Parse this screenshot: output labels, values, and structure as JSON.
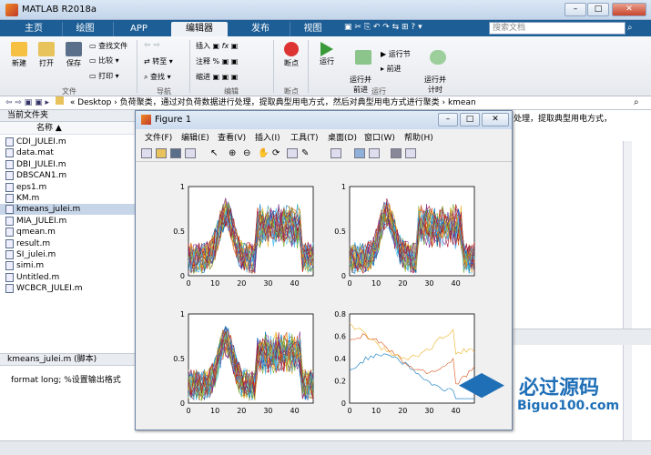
{
  "app": {
    "title": "MATLAB R2018a"
  },
  "tabs": [
    "主页",
    "绘图",
    "APP",
    "编辑器",
    "发布",
    "视图"
  ],
  "active_tab": 3,
  "search": {
    "placeholder": "搜索文档"
  },
  "ribbon": {
    "file_group": {
      "label": "文件",
      "new": "新建",
      "open": "打开",
      "save": "保存",
      "find_files": "查找文件",
      "compare": "比较",
      "print": "打印"
    },
    "nav_group": {
      "label": "导航",
      "goto": "转至",
      "find": "查找"
    },
    "edit_group": {
      "label": "编辑",
      "insert": "插入",
      "comment": "注释",
      "indent": "缩进"
    },
    "breakpoint_group": {
      "label": "断点",
      "breakpoint": "断点"
    },
    "run_group": {
      "label": "运行",
      "run": "运行",
      "run_advance": "运行并\n前进",
      "run_section": "运行节",
      "advance": "前进",
      "run_time": "运行并\n计时"
    }
  },
  "address": {
    "path": "« Desktop › 负荷聚类，通过对负荷数据进行处理，提取典型用电方式，然后对典型用电方式进行聚类 › kmean"
  },
  "current_folder": {
    "title": "当前文件夹",
    "col_name": "名称",
    "files": [
      "CDI_JULEI.m",
      "data.mat",
      "DBI_JULEI.m",
      "DBSCAN1.m",
      "eps1.m",
      "KM.m",
      "kmeans_julei.m",
      "MIA_JULEI.m",
      "qmean.m",
      "result.m",
      "SI_julei.m",
      "simi.m",
      "Untitled.m",
      "WCBCR_JULEI.m"
    ],
    "selected_index": 6
  },
  "details": {
    "header": "kmeans_julei.m (脚本)",
    "content": "format long; %设置输出格式"
  },
  "right_text": "处理，提取典型用电方式，",
  "figure": {
    "title": "Figure 1",
    "menu": [
      "文件(F)",
      "编辑(E)",
      "查看(V)",
      "插入(I)",
      "工具(T)",
      "桌面(D)",
      "窗口(W)",
      "帮助(H)"
    ],
    "axes": [
      {
        "yticks": [
          "0",
          "0.5",
          "1"
        ],
        "xticks": [
          "0",
          "10",
          "20",
          "30",
          "40"
        ]
      },
      {
        "yticks": [
          "0",
          "0.5",
          "1"
        ],
        "xticks": [
          "0",
          "10",
          "20",
          "30",
          "40"
        ]
      },
      {
        "yticks": [
          "0",
          "0.5",
          "1"
        ],
        "xticks": [
          "0",
          "10",
          "20",
          "30",
          "40"
        ]
      },
      {
        "yticks": [
          "0",
          "0.2",
          "0.4",
          "0.6",
          "0.8"
        ],
        "xticks": [
          "0",
          "10",
          "20",
          "30",
          "40"
        ]
      }
    ]
  },
  "logo": {
    "text": "必过源码",
    "url": "Biguo100.com"
  },
  "colors": {
    "accent": "#1d5e96",
    "selection": "#c7d5e8"
  }
}
